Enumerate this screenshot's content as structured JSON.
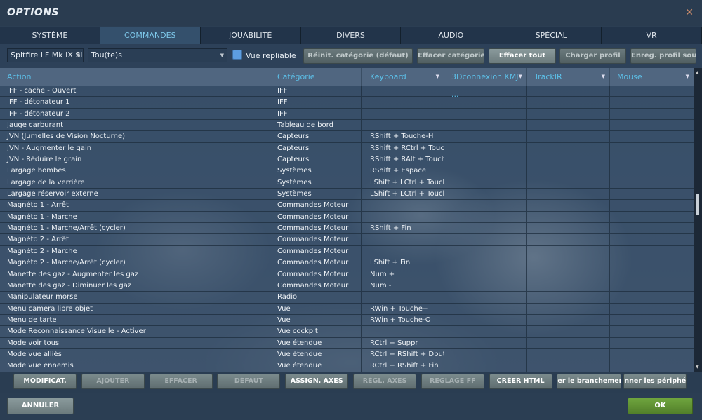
{
  "window": {
    "title": "OPTIONS",
    "close": "✕"
  },
  "tabs": [
    "SYSTÈME",
    "COMMANDES",
    "JOUABILITÉ",
    "DIVERS",
    "AUDIO",
    "SPÉCIAL",
    "VR"
  ],
  "active_tab": "COMMANDES",
  "toolbar": {
    "aircraft": "Spitfire LF Mk IX Sim",
    "category_filter": "Tou(te)s",
    "collapsible_label": "Vue repliable",
    "collapsible_checked": true,
    "buttons": [
      "Réinit. catégorie (défaut)",
      "Effacer catégorie",
      "Effacer tout",
      "Charger profil",
      "Enreg. profil sous"
    ]
  },
  "columns": [
    "Action",
    "Catégorie",
    "Keyboard",
    "3Dconnexion KMJ ...",
    "TrackIR",
    "Mouse"
  ],
  "rows": [
    [
      "IFF - cache - Ouvert",
      "IFF",
      ""
    ],
    [
      "IFF - détonateur 1",
      "IFF",
      ""
    ],
    [
      "IFF - détonateur 2",
      "IFF",
      ""
    ],
    [
      "Jauge carburant",
      "Tableau de bord",
      ""
    ],
    [
      "JVN (Jumelles de Vision Nocturne)",
      "Capteurs",
      "RShift + Touche-H"
    ],
    [
      "JVN - Augmenter le gain",
      "Capteurs",
      "RShift + RCtrl + Touche"
    ],
    [
      "JVN - Réduire le grain",
      "Capteurs",
      "RShift + RAlt + Touche"
    ],
    [
      "Largage bombes",
      "Systèmes",
      "RShift + Espace"
    ],
    [
      "Largage de la verrière",
      "Systèmes",
      "LShift + LCtrl + Touche"
    ],
    [
      "Largage réservoir externe",
      "Systèmes",
      "LShift + LCtrl + Touche"
    ],
    [
      "Magnéto 1 - Arrêt",
      "Commandes Moteur",
      ""
    ],
    [
      "Magnéto 1 - Marche",
      "Commandes Moteur",
      ""
    ],
    [
      "Magnéto 1 - Marche/Arrêt (cycler)",
      "Commandes Moteur",
      "RShift + Fin"
    ],
    [
      "Magnéto 2 - Arrêt",
      "Commandes Moteur",
      ""
    ],
    [
      "Magnéto 2 - Marche",
      "Commandes Moteur",
      ""
    ],
    [
      "Magnéto 2 - Marche/Arrêt (cycler)",
      "Commandes Moteur",
      "LShift + Fin"
    ],
    [
      "Manette des gaz - Augmenter les gaz",
      "Commandes Moteur",
      "Num +"
    ],
    [
      "Manette des gaz - Diminuer les gaz",
      "Commandes Moteur",
      "Num -"
    ],
    [
      "Manipulateur morse",
      "Radio",
      ""
    ],
    [
      "Menu camera libre objet",
      "Vue",
      "RWin + Touche--"
    ],
    [
      "Menu de tarte",
      "Vue",
      "RWin + Touche-O"
    ],
    [
      "Mode Reconnaissance Visuelle - Activer",
      "Vue cockpit",
      ""
    ],
    [
      "Mode voir tous",
      "Vue étendue",
      "RCtrl + Suppr"
    ],
    [
      "Mode vue alliés",
      "Vue étendue",
      "RCtrl + RShift + Dbut"
    ],
    [
      "Mode vue ennemis",
      "Vue étendue",
      "RCtrl + RShift + Fin"
    ]
  ],
  "action_buttons": [
    "MODIFICAT.",
    "AJOUTER",
    "EFFACER",
    "DÉFAUT",
    "ASSIGN. AXES",
    "RÉGL. AXES",
    "RÉGLAGE FF",
    "CRÉER HTML",
    "er le branchement",
    "nner les périphéi"
  ],
  "footer": {
    "cancel": "ANNULER",
    "ok": "OK"
  },
  "colors": {
    "accent": "#5cc0e8",
    "ok": "#5e8f34"
  }
}
